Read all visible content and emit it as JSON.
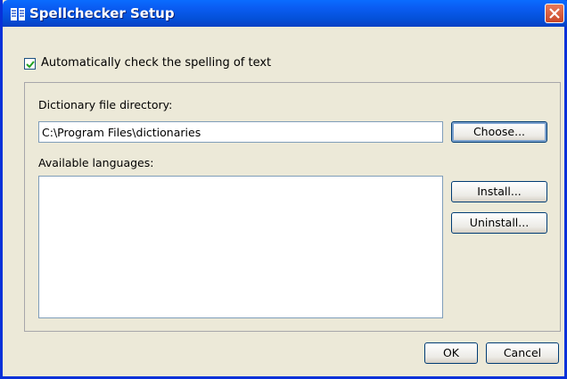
{
  "window": {
    "title": "Spellchecker Setup"
  },
  "auto_check": {
    "label": "Automatically check the spelling of text",
    "checked": true
  },
  "dictionary": {
    "label": "Dictionary file directory:",
    "value": "C:\\Program Files\\dictionaries",
    "choose_label": "Choose..."
  },
  "languages": {
    "label": "Available languages:",
    "items": [],
    "install_label": "Install...",
    "uninstall_label": "Uninstall..."
  },
  "footer": {
    "ok_label": "OK",
    "cancel_label": "Cancel"
  },
  "colors": {
    "titlebar": "#0a5cf2",
    "window_bg": "#ece9d8",
    "close": "#c9482a"
  },
  "icons": {
    "app": "spellchecker-app-icon",
    "close": "close-icon",
    "check": "checkmark-icon"
  }
}
